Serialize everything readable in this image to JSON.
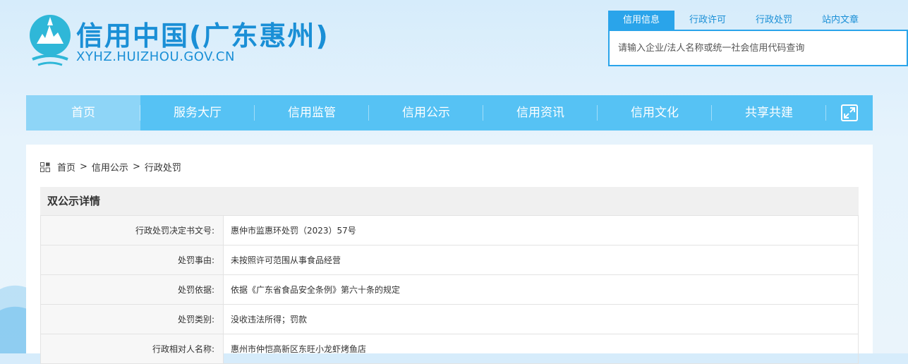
{
  "site": {
    "title": "信用中国(广东惠州)",
    "url": "XYHZ.HUIZHOU.GOV.CN",
    "brand_color": "#1a8fd6"
  },
  "search": {
    "tabs": [
      {
        "label": "信用信息",
        "active": true
      },
      {
        "label": "行政许可",
        "active": false
      },
      {
        "label": "行政处罚",
        "active": false
      },
      {
        "label": "站内文章",
        "active": false
      }
    ],
    "placeholder": "请输入企业/法人名称或统一社会信用代码查询"
  },
  "nav": {
    "items": [
      {
        "label": "首页",
        "active": true
      },
      {
        "label": "服务大厅"
      },
      {
        "label": "信用监管"
      },
      {
        "label": "信用公示"
      },
      {
        "label": "信用资讯"
      },
      {
        "label": "信用文化"
      },
      {
        "label": "共享共建"
      }
    ],
    "expand_icon": "expand-icon",
    "bar_color": "#56c2f4"
  },
  "breadcrumb": {
    "icon": "grid-icon",
    "items": [
      "首页",
      "信用公示",
      "行政处罚"
    ],
    "separator": ">"
  },
  "detail": {
    "title": "双公示详情",
    "rows": [
      {
        "label": "行政处罚决定书文号:",
        "value": "惠仲市监惠环处罚（2023）57号"
      },
      {
        "label": "处罚事由:",
        "value": "未按照许可范围从事食品经营"
      },
      {
        "label": "处罚依据:",
        "value": "依据《广东省食品安全条例》第六十条的规定"
      },
      {
        "label": "处罚类别:",
        "value": "没收违法所得；罚款"
      },
      {
        "label": "行政相对人名称:",
        "value": "惠州市仲恺高新区东旺小龙虾烤鱼店"
      }
    ]
  }
}
